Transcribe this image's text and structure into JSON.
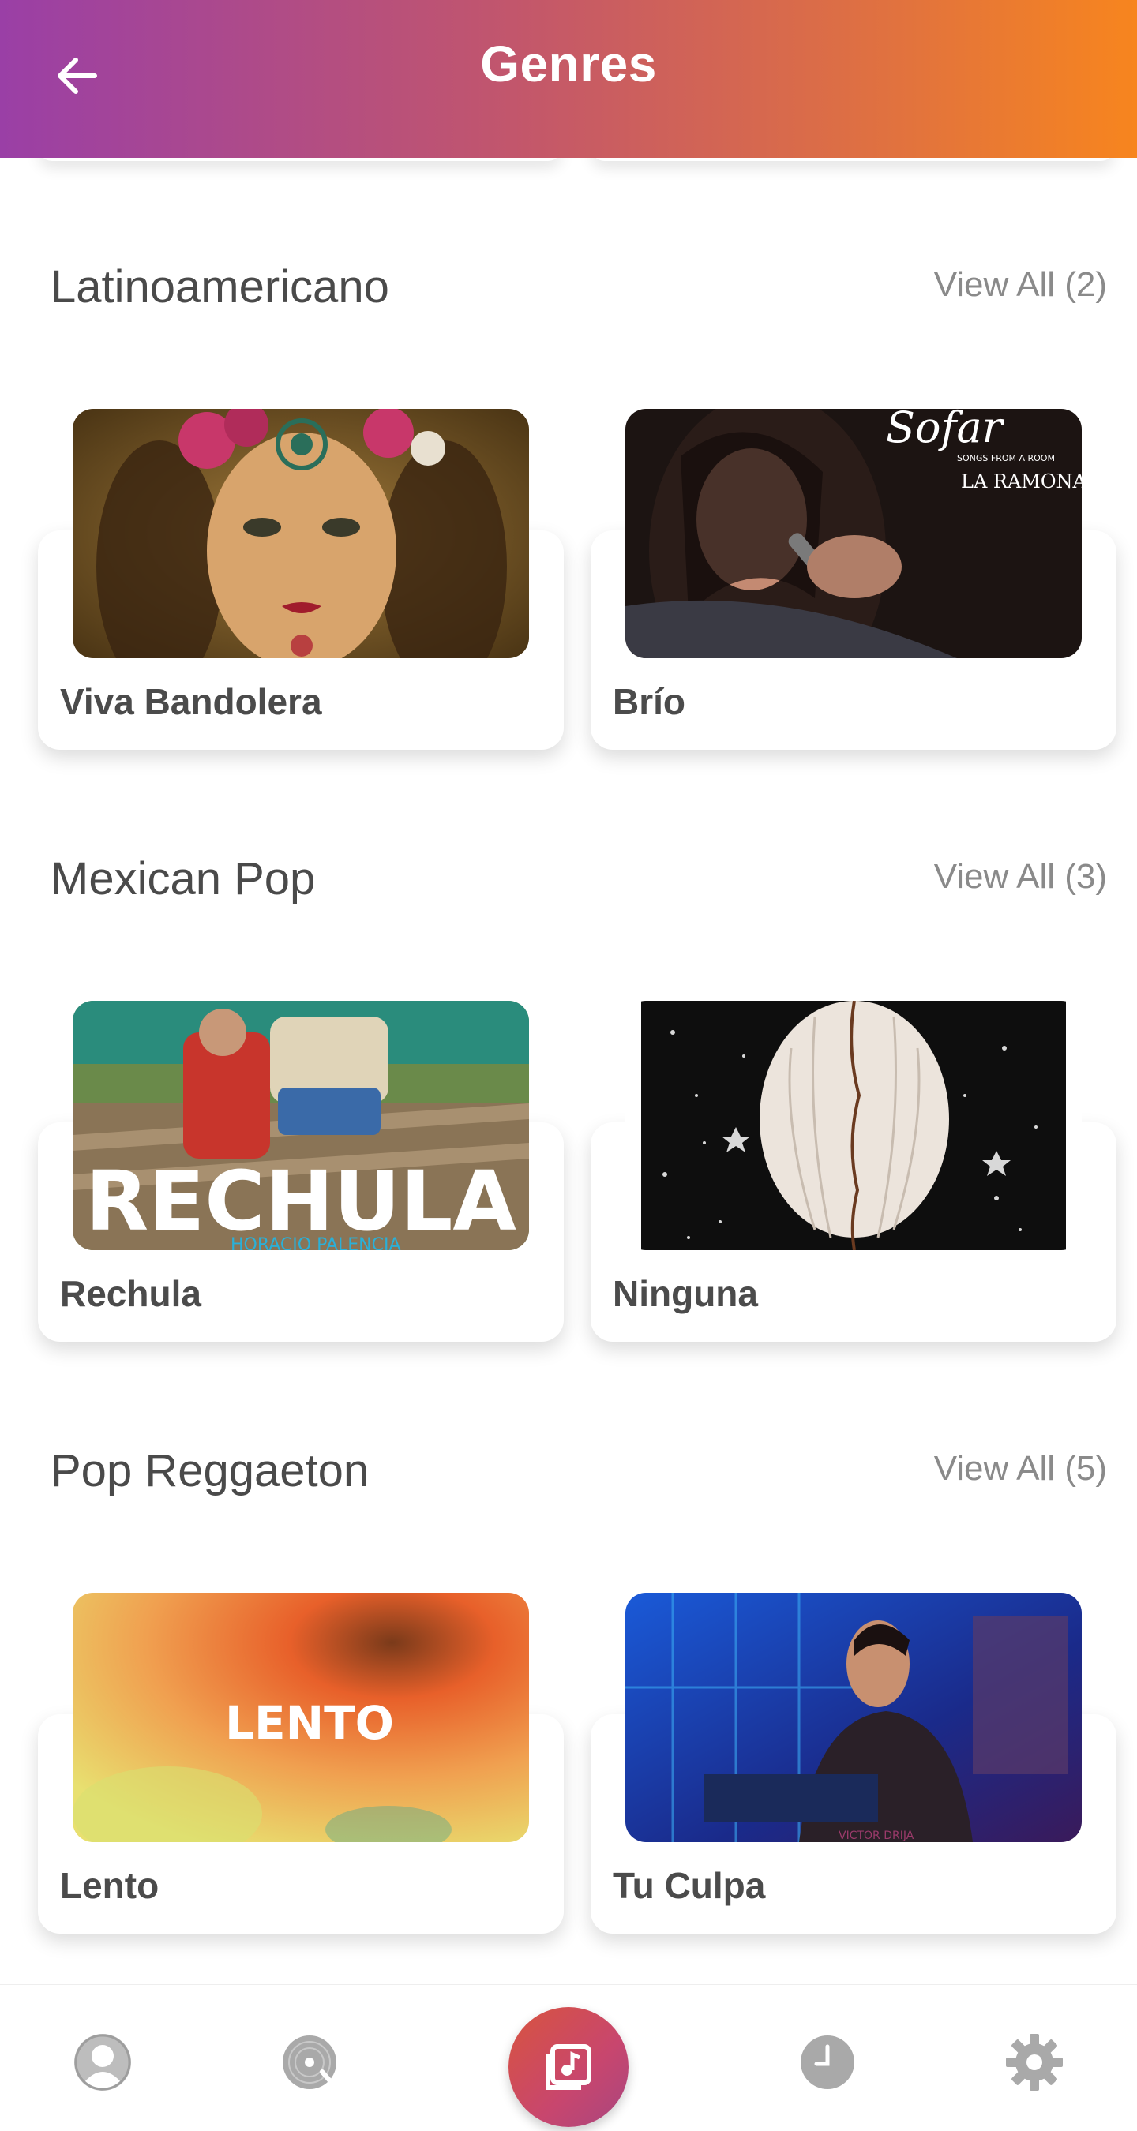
{
  "header": {
    "title": "Genres",
    "back_icon": "arrow-left-icon"
  },
  "sections": [
    {
      "title": "Latinoamericano",
      "view_all": "View All (2)",
      "items": [
        {
          "name": "Viva Bandolera"
        },
        {
          "name": "Brío"
        }
      ]
    },
    {
      "title": "Mexican Pop",
      "view_all": "View All (3)",
      "items": [
        {
          "name": "Rechula"
        },
        {
          "name": "Ninguna"
        }
      ]
    },
    {
      "title": "Pop Reggaeton",
      "view_all": "View All (5)",
      "items": [
        {
          "name": "Lento"
        },
        {
          "name": "Tu Culpa"
        }
      ]
    }
  ],
  "artwork_text": {
    "brio_badge": "Sofar",
    "brio_sub": "SONGS FROM A ROOM",
    "brio_artist": "LA RAMONA",
    "rechula": "RECHULA",
    "rechula_sub": "HORACIO PALENCIA",
    "lento": "LENTO",
    "tuculpa": "VICTOR DRIJA"
  },
  "bottom_nav": [
    {
      "icon": "profile-icon"
    },
    {
      "icon": "vinyl-record-icon"
    },
    {
      "icon": "music-library-icon",
      "active": true
    },
    {
      "icon": "clock-icon"
    },
    {
      "icon": "gear-icon"
    }
  ],
  "colors": {
    "header_start": "#9a3fa6",
    "header_end": "#f7851e",
    "center_button": "#d8543e"
  }
}
